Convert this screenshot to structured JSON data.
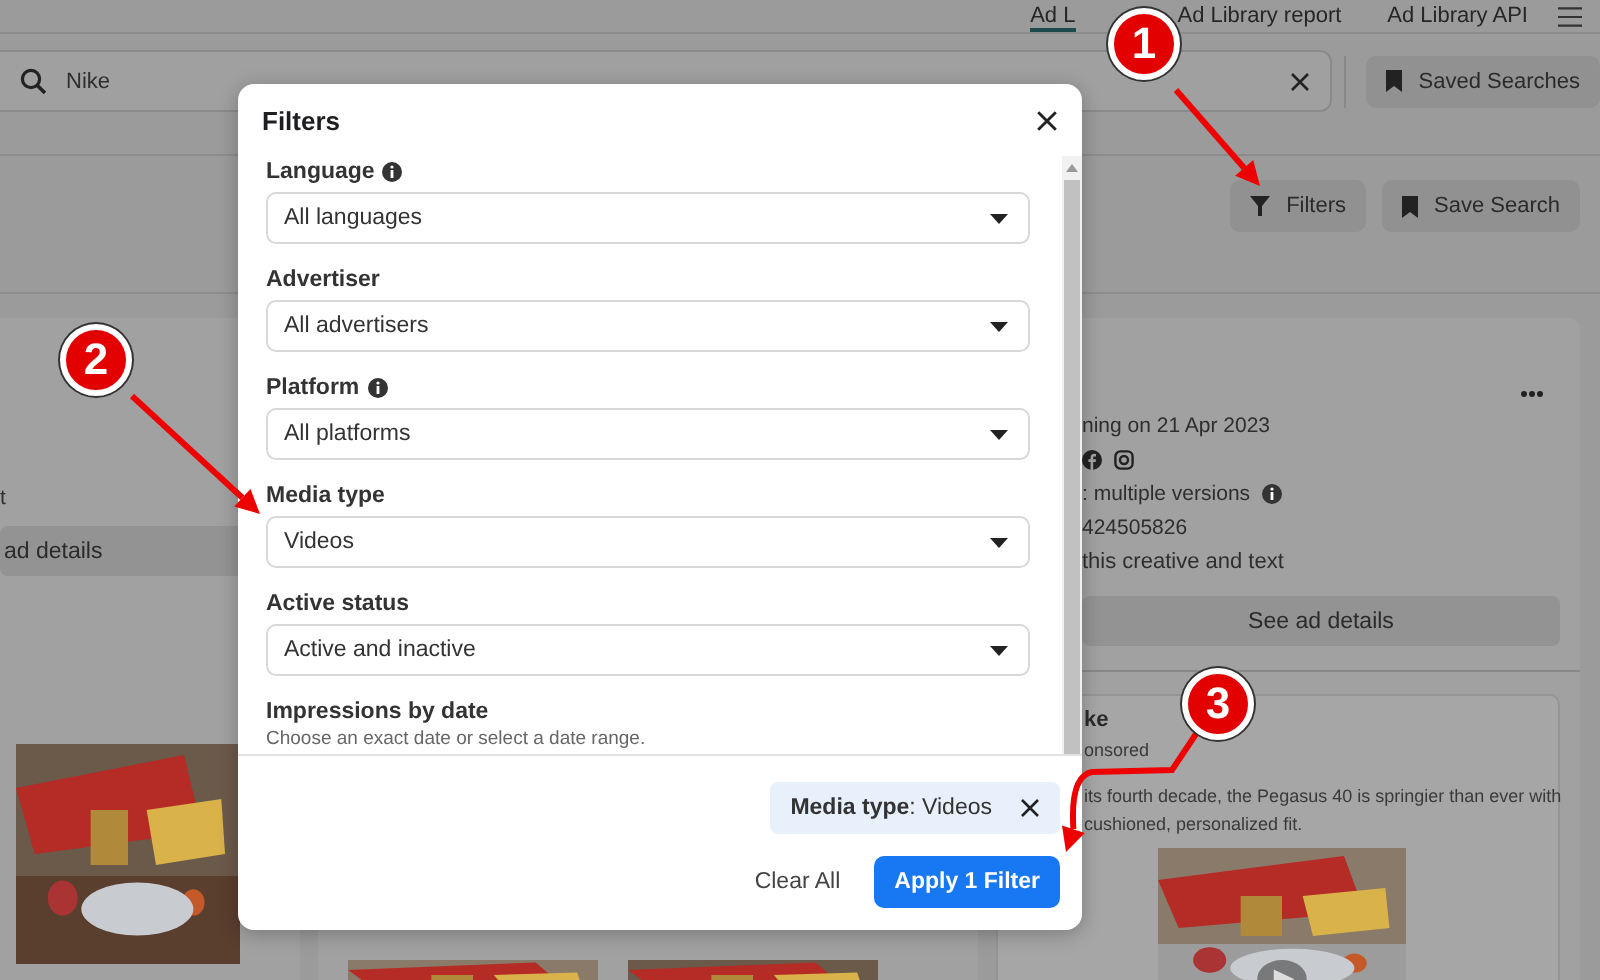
{
  "nav": {
    "tabs": [
      {
        "label": "Ad L",
        "selected": true
      },
      {
        "label": "Ad Library report",
        "selected": false
      },
      {
        "label": "Ad Library API",
        "selected": false
      }
    ]
  },
  "search": {
    "value": "Nike",
    "saved_searches": "Saved Searches"
  },
  "toolbar": {
    "filters": "Filters",
    "save_search": "Save Search"
  },
  "left_card": {
    "line": "t",
    "button": "ad details"
  },
  "right_card": {
    "started": "ning on 21 Apr 2023",
    "versions": ": multiple versions",
    "id": "424505826",
    "creative": "this creative and text",
    "details_button": "See ad details",
    "ad": {
      "advertiser": "ke",
      "sponsored": "onsored",
      "body": "its fourth decade, the Pegasus 40 is springier than ever with",
      "body_2": "cushioned, personalized fit."
    }
  },
  "modal": {
    "title": "Filters",
    "fields": [
      {
        "label": "Language",
        "info": true,
        "value": "All languages"
      },
      {
        "label": "Advertiser",
        "info": false,
        "value": "All advertisers"
      },
      {
        "label": "Platform",
        "info": true,
        "value": "All platforms"
      },
      {
        "label": "Media type",
        "info": false,
        "value": "Videos"
      },
      {
        "label": "Active status",
        "info": false,
        "value": "Active and inactive"
      }
    ],
    "date": {
      "label": "Impressions by date",
      "hint": "Choose an exact date or select a date range."
    },
    "chip": "**Media type**: Videos",
    "clear": "Clear All",
    "apply": "Apply 1 Filter"
  },
  "annotations": [
    {
      "number": "1"
    },
    {
      "number": "2"
    },
    {
      "number": "3"
    }
  ]
}
